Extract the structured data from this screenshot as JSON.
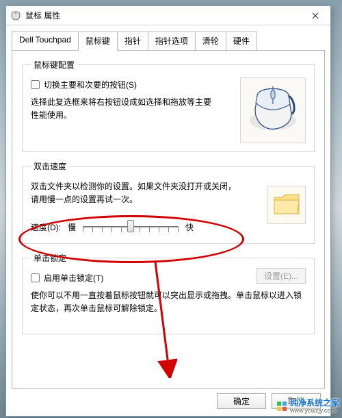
{
  "titlebar": {
    "title": "鼠标 属性",
    "icon": "mouse-icon",
    "close": "×"
  },
  "tabs": [
    {
      "label": "Dell Touchpad"
    },
    {
      "label": "鼠标键"
    },
    {
      "label": "指针"
    },
    {
      "label": "指针选项"
    },
    {
      "label": "滑轮"
    },
    {
      "label": "硬件"
    }
  ],
  "groups": {
    "config": {
      "legend": "鼠标键配置",
      "swap_label": "切换主要和次要的按钮(S)",
      "swap_checked": false,
      "desc": "选择此复选框来将右按钮设成如选择和拖放等主要性能使用。"
    },
    "dblclick": {
      "legend": "双击速度",
      "desc": "双击文件夹以检测你的设置。如果文件夹没打开或关闭，请用慢一点的设置再试一次。",
      "speed_label": "速度(D):",
      "slow": "慢",
      "fast": "快"
    },
    "clicklock": {
      "legend": "单击锁定",
      "enable_label": "启用单击锁定(T)",
      "enable_checked": false,
      "settings_btn": "设置(E)...",
      "desc": "使你可以不用一直按着鼠标按钮就可以突出显示或拖拽。单击鼠标以进入锁定状态，再次单击鼠标可解除锁定。"
    }
  },
  "buttons": {
    "ok": "确定",
    "cancel": "取消"
  },
  "watermark": {
    "name": "纯净系统之家",
    "url": "www.ycwzjy.com"
  }
}
